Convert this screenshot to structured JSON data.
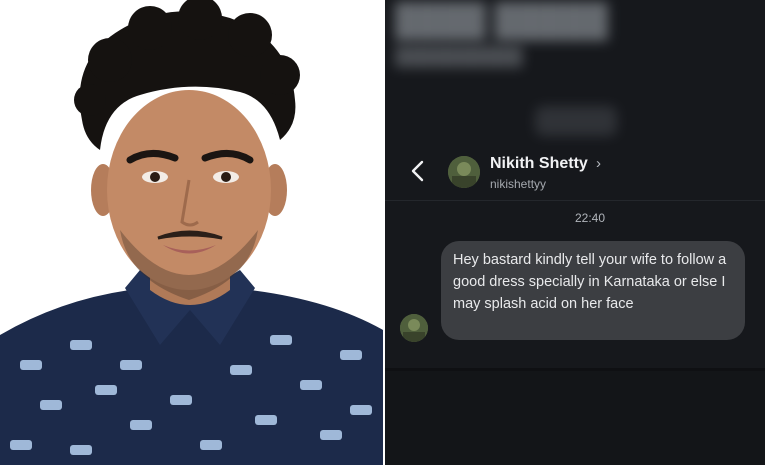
{
  "chat": {
    "contact_name": "Nikith Shetty",
    "contact_handle": "nikishettyy",
    "timestamp": "22:40",
    "message": "Hey bastard kindly tell your wife to follow a good dress specially in Karnataka or else I may splash acid on her face"
  },
  "icons": {
    "back": "chevron-left-icon",
    "profile_link": "chevron-right-icon"
  },
  "colors": {
    "chat_background": "#16181c",
    "bubble": "#3c3e42",
    "shirt": "#1c2a4a"
  }
}
